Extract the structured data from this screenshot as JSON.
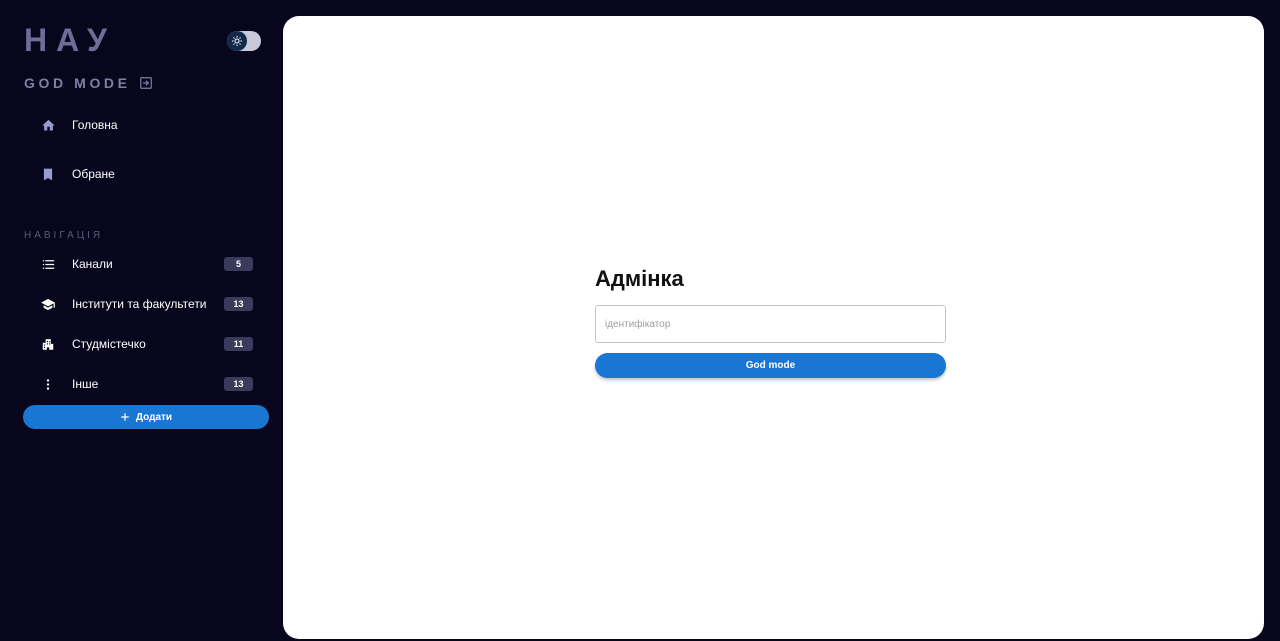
{
  "sidebar": {
    "logo": "НАУ",
    "mode_label": "GOD MODE",
    "main_items": [
      {
        "label": "Головна",
        "icon": "home-icon"
      },
      {
        "label": "Обране",
        "icon": "bookmark-icon"
      }
    ],
    "section_label": "НАВІГАЦІЯ",
    "nav_items": [
      {
        "label": "Канали",
        "icon": "list-icon",
        "count": "5"
      },
      {
        "label": "Інститути та факультети",
        "icon": "graduation-cap-icon",
        "count": "13"
      },
      {
        "label": "Студмістечко",
        "icon": "building-icon",
        "count": "11"
      },
      {
        "label": "Інше",
        "icon": "more-vertical-icon",
        "count": "13"
      }
    ],
    "add_label": "Додати"
  },
  "admin": {
    "title": "Адмінка",
    "id_placeholder": "ідентифікатор",
    "id_value": "",
    "submit_label": "God mode"
  },
  "colors": {
    "background": "#07061c",
    "accent": "#1976d2",
    "badge": "#3a3b5a",
    "logo": "#6d6d96"
  }
}
